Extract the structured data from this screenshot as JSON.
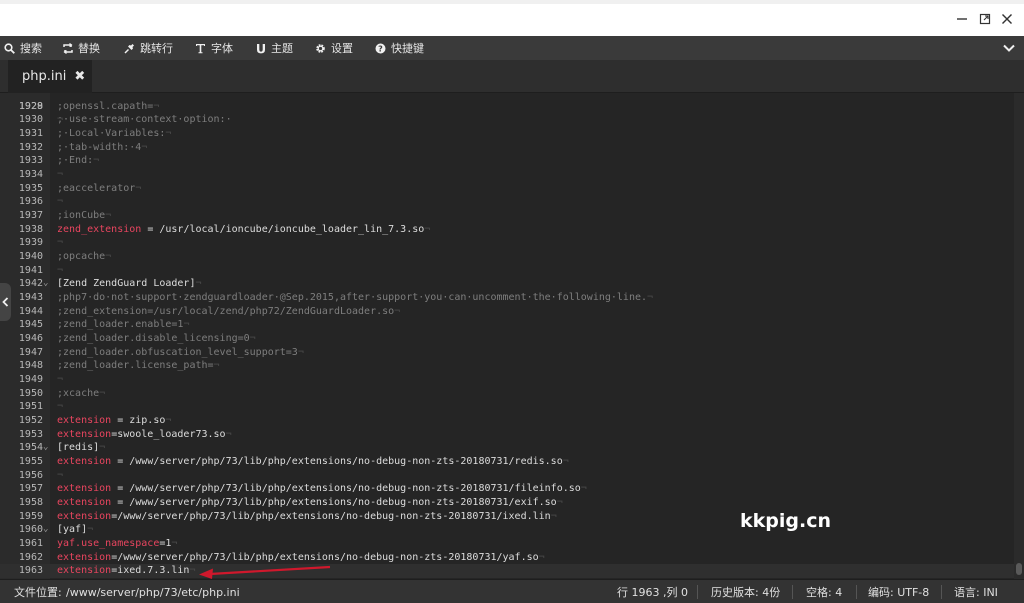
{
  "window": {
    "minimize_icon": "minimize-icon",
    "maximize_icon": "maximize-icon",
    "close_icon": "close-icon"
  },
  "toolbar": {
    "items": [
      {
        "icon": "search-icon",
        "label": "搜索"
      },
      {
        "icon": "replace-icon",
        "label": "替换"
      },
      {
        "icon": "pin-icon",
        "label": "跳转行"
      },
      {
        "icon": "font-icon",
        "label": "字体"
      },
      {
        "icon": "theme-icon",
        "label": "主题"
      },
      {
        "icon": "gear-icon",
        "label": "设置"
      },
      {
        "icon": "help-icon",
        "label": "快捷键"
      }
    ],
    "collapse_icon": "chevron-down-icon"
  },
  "tab": {
    "label": "php.ini",
    "close_glyph": "✖"
  },
  "editor": {
    "top_partial": ";·use·stream·context·option:·",
    "lines": [
      {
        "n": "1929",
        "segs": [
          {
            "t": ";openssl.capath=",
            "c": "comment"
          }
        ]
      },
      {
        "n": "1930",
        "segs": []
      },
      {
        "n": "1931",
        "segs": [
          {
            "t": ";·Local·Variables:",
            "c": "comment"
          }
        ]
      },
      {
        "n": "1932",
        "segs": [
          {
            "t": ";·tab-width:·4",
            "c": "comment"
          }
        ]
      },
      {
        "n": "1933",
        "segs": [
          {
            "t": ";·End:",
            "c": "comment"
          }
        ]
      },
      {
        "n": "1934",
        "segs": []
      },
      {
        "n": "1935",
        "segs": [
          {
            "t": ";eaccelerator",
            "c": "comment"
          }
        ]
      },
      {
        "n": "1936",
        "segs": []
      },
      {
        "n": "1937",
        "segs": [
          {
            "t": ";ionCube",
            "c": "comment"
          }
        ]
      },
      {
        "n": "1938",
        "segs": [
          {
            "t": "zend_extension",
            "c": "key"
          },
          {
            "t": " = /usr/local/ioncube/ioncube_loader_lin_7.3.so",
            "c": "val"
          }
        ]
      },
      {
        "n": "1939",
        "segs": []
      },
      {
        "n": "1940",
        "segs": [
          {
            "t": ";opcache",
            "c": "comment"
          }
        ]
      },
      {
        "n": "1941",
        "segs": []
      },
      {
        "n": "1942",
        "segs": [
          {
            "t": "[Zend ZendGuard Loader]",
            "c": "val"
          }
        ]
      },
      {
        "n": "1943",
        "segs": [
          {
            "t": ";php7·do·not·support·zendguardloader·@Sep.2015,after·support·you·can·uncomment·the·following·line.",
            "c": "comment"
          }
        ]
      },
      {
        "n": "1944",
        "segs": [
          {
            "t": ";zend_extension=/usr/local/zend/php72/ZendGuardLoader.so",
            "c": "comment"
          }
        ]
      },
      {
        "n": "1945",
        "segs": [
          {
            "t": ";zend_loader.enable=1",
            "c": "comment"
          }
        ]
      },
      {
        "n": "1946",
        "segs": [
          {
            "t": ";zend_loader.disable_licensing=0",
            "c": "comment"
          }
        ]
      },
      {
        "n": "1947",
        "segs": [
          {
            "t": ";zend_loader.obfuscation_level_support=3",
            "c": "comment"
          }
        ]
      },
      {
        "n": "1948",
        "segs": [
          {
            "t": ";zend_loader.license_path=",
            "c": "comment"
          }
        ]
      },
      {
        "n": "1949",
        "segs": []
      },
      {
        "n": "1950",
        "segs": [
          {
            "t": ";xcache",
            "c": "comment"
          }
        ]
      },
      {
        "n": "1951",
        "segs": []
      },
      {
        "n": "1952",
        "segs": [
          {
            "t": "extension",
            "c": "key"
          },
          {
            "t": " = zip.so",
            "c": "val"
          }
        ]
      },
      {
        "n": "1953",
        "segs": [
          {
            "t": "extension",
            "c": "key"
          },
          {
            "t": "=swoole_loader73.so",
            "c": "val"
          }
        ]
      },
      {
        "n": "1954",
        "segs": [
          {
            "t": "[redis]",
            "c": "val"
          }
        ]
      },
      {
        "n": "1955",
        "segs": [
          {
            "t": "extension",
            "c": "key"
          },
          {
            "t": " = /www/server/php/73/lib/php/extensions/no-debug-non-zts-20180731/redis.so",
            "c": "val"
          }
        ]
      },
      {
        "n": "1956",
        "segs": []
      },
      {
        "n": "1957",
        "segs": [
          {
            "t": "extension",
            "c": "key"
          },
          {
            "t": " = /www/server/php/73/lib/php/extensions/no-debug-non-zts-20180731/fileinfo.so",
            "c": "val"
          }
        ]
      },
      {
        "n": "1958",
        "segs": [
          {
            "t": "extension",
            "c": "key"
          },
          {
            "t": " = /www/server/php/73/lib/php/extensions/no-debug-non-zts-20180731/exif.so",
            "c": "val"
          }
        ]
      },
      {
        "n": "1959",
        "segs": [
          {
            "t": "extension",
            "c": "key"
          },
          {
            "t": "=/www/server/php/73/lib/php/extensions/no-debug-non-zts-20180731/ixed.lin",
            "c": "val"
          }
        ]
      },
      {
        "n": "1960",
        "segs": [
          {
            "t": "[yaf]",
            "c": "val"
          }
        ]
      },
      {
        "n": "1961",
        "segs": [
          {
            "t": "yaf.use_namespace",
            "c": "key"
          },
          {
            "t": "=1",
            "c": "val"
          }
        ]
      },
      {
        "n": "1962",
        "segs": [
          {
            "t": "extension",
            "c": "key"
          },
          {
            "t": "=/www/server/php/73/lib/php/extensions/no-debug-non-zts-20180731/yaf.so",
            "c": "val"
          }
        ]
      },
      {
        "n": "1963",
        "segs": [
          {
            "t": "extension",
            "c": "key"
          },
          {
            "t": "=ixed.7.3.lin",
            "c": "val"
          }
        ]
      }
    ]
  },
  "watermark": "kkpig.cn",
  "status": {
    "file_label": "文件位置:",
    "file_path": "/www/server/php/73/etc/php.ini",
    "position": "行 1963 ,列 0",
    "history": "历史版本: 4份",
    "indent": "空格: 4",
    "encoding": "编码: UTF-8",
    "language": "语言: INI"
  },
  "colors": {
    "key": "#e8455f",
    "comment": "#7e7e7e",
    "arrow": "#d0182c"
  }
}
